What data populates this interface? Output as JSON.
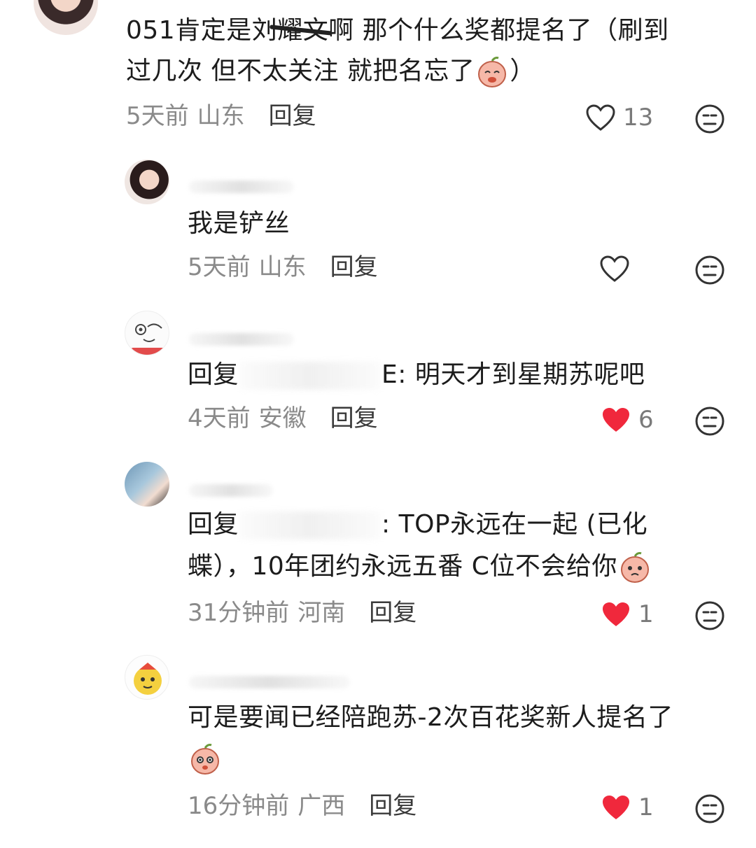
{
  "comments": [
    {
      "text_a": "051肯定是刘耀文啊 那个什么奖都提名了（刷到",
      "text_b": "过几次 但不太关注 就把名忘了",
      "text_c": "）",
      "time": "5天前",
      "location": "山东",
      "reply": "回复",
      "likes": "13",
      "liked": false
    },
    {
      "text": "我是铲丝",
      "time": "5天前",
      "location": "山东",
      "reply": "回复",
      "likes": "",
      "liked": false
    },
    {
      "prefix": "回复",
      "tail": "E: 明天才到星期苏呢吧",
      "time": "4天前",
      "location": "安徽",
      "reply": "回复",
      "likes": "6",
      "liked": true
    },
    {
      "prefix": "回复",
      "tail": ": TOP永远在一起 (已化",
      "text_b": "蝶），10年团约永远五番 C位不会给你",
      "time": "31分钟前",
      "location": "河南",
      "reply": "回复",
      "likes": "1",
      "liked": true
    },
    {
      "text_a": "可是要闻已经陪跑苏-2次百花奖新人提名了",
      "time": "16分钟前",
      "location": "广西",
      "reply": "回复",
      "likes": "1",
      "liked": true
    }
  ],
  "colors": {
    "like_red": "#f0283c",
    "meta_gray": "#8a8a8a",
    "text": "#1c1c1c"
  },
  "icons": [
    "heart-outline-icon",
    "heart-filled-icon",
    "dislike-face-icon",
    "emoji-peach-icon"
  ]
}
